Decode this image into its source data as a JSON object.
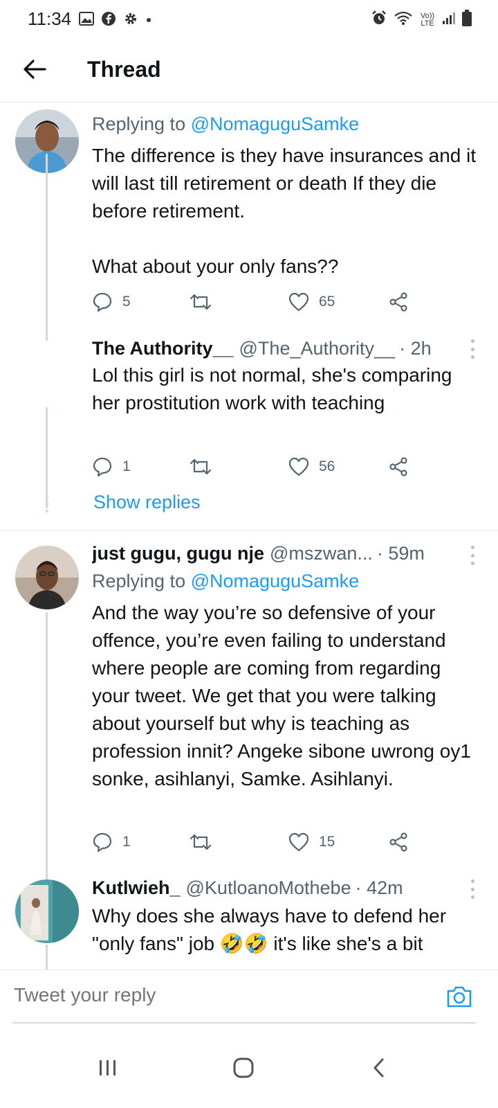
{
  "status_bar": {
    "time": "11:34",
    "left_icons": [
      "gallery-icon",
      "facebook-icon",
      "settings-icon",
      "dot-icon"
    ],
    "right_icons": [
      "alarm-icon",
      "wifi-icon",
      "volte-icon",
      "signal-icon",
      "battery-icon"
    ],
    "volte_label": "Vo)) LTE"
  },
  "header": {
    "title": "Thread"
  },
  "tweets": [
    {
      "reply_prefix": "Replying to",
      "reply_mention": "@NomaguguSamke",
      "text": "The difference is they have insurances and it will last till retirement or death If they die before retirement.\n\nWhat about your only fans??",
      "replies": "5",
      "retweets": "",
      "likes": "65"
    },
    {
      "name": "The Authority__",
      "handle": "@The_Authority__",
      "time": "· 2h",
      "text": "Lol this girl is not normal, she's comparing her prostitution work with teaching",
      "replies": "1",
      "retweets": "",
      "likes": "56"
    },
    {
      "name": "just gugu, gugu nje",
      "handle": "@mszwan...",
      "time": "· 59m",
      "reply_prefix": "Replying to",
      "reply_mention": "@NomaguguSamke",
      "text": "And the way you’re so defensive of your offence, you’re even failing to understand where people are coming from regarding your tweet. We get that you were talking about yourself but why is teaching as profession innit? Angeke sibone uwrong oy1 sonke, asihlanyi, Samke. Asihlanyi.",
      "replies": "1",
      "retweets": "",
      "likes": "15"
    },
    {
      "name": "Kutlwieh_",
      "handle": "@KutloanoMothebe",
      "time": "· 42m",
      "text": "Why does she always have to defend her \"only fans\" job 🤣🤣 it's like she's a bit"
    }
  ],
  "show_replies": "Show replies",
  "composer": {
    "placeholder": "Tweet your reply"
  },
  "colors": {
    "accent": "#1d9bf0",
    "text": "#0f1419",
    "secondary": "#536471",
    "thread_line": "#cfd9de"
  }
}
